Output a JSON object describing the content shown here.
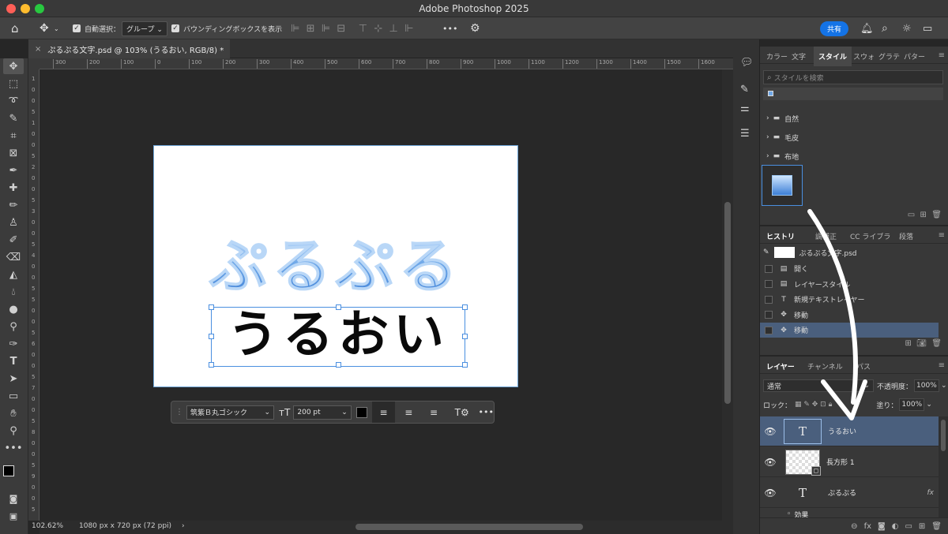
{
  "app": {
    "title": "Adobe Photoshop 2025"
  },
  "options": {
    "auto_select_label": "自動選択：",
    "auto_select_value": "グループ",
    "bbox_label": "バウンディングボックスを表示",
    "share_label": "共有",
    "more": "•••"
  },
  "document": {
    "tab_title": "ぷるぷる文字.psd @ 103% (うるおい, RGB/8) *",
    "title_text": "ぷるぷる",
    "body_text": "うるおい",
    "zoom": "102.62%",
    "dims": "1080 px x 720 px (72 ppi)"
  },
  "ruler": {
    "h_ticks": [
      "300",
      "200",
      "100",
      "0",
      "100",
      "200",
      "300",
      "400",
      "500",
      "600",
      "700",
      "800",
      "900",
      "1000",
      "1100",
      "1200",
      "1300",
      "1400",
      "1500",
      "1600"
    ],
    "v_ticks": [
      "1",
      "0",
      "0",
      "5",
      "1",
      "0",
      "0",
      "5",
      "2",
      "0",
      "0",
      "5",
      "3",
      "0",
      "0",
      "5",
      "4",
      "0",
      "0",
      "5",
      "5",
      "0",
      "0",
      "5",
      "6",
      "0",
      "0",
      "5",
      "7",
      "0",
      "0",
      "5",
      "8",
      "0",
      "0",
      "5",
      "9",
      "0",
      "0",
      "5"
    ]
  },
  "context_bar": {
    "font": "筑紫Ｂ丸ゴシック",
    "size": "200 pt",
    "more": "•••"
  },
  "styles_panel": {
    "tabs": [
      "カラー",
      "文字",
      "スタイル",
      "スウォ",
      "グラテ",
      "パター"
    ],
    "active_tab": "スタイル",
    "search_placeholder": "スタイルを検索",
    "folders": [
      "自然",
      "毛皮",
      "布地"
    ]
  },
  "history_panel": {
    "tabs": [
      "ヒストリ",
      "調補正",
      "CC ライブラ",
      "段落"
    ],
    "snapshot": "ぷるぷる文字.psd",
    "items": [
      "開く",
      "レイヤースタイル",
      "新規テキストレイヤー",
      "移動",
      "移動"
    ]
  },
  "layers_panel": {
    "tabs": [
      "レイヤー",
      "チャンネル",
      "パス"
    ],
    "blend_mode": "通常",
    "opacity_label": "不透明度：",
    "opacity": "100%",
    "lock_label": "ロック：",
    "fill_label": "塗り：",
    "fill": "100%",
    "layers": [
      {
        "name": "うるおい",
        "type": "T",
        "selected": true
      },
      {
        "name": "長方形 1",
        "type": "shape",
        "selected": false
      },
      {
        "name": "ぷるぷる",
        "type": "T",
        "selected": false,
        "fx": "fx"
      }
    ],
    "effect_label": "効果"
  },
  "colors": {
    "accent": "#1473e6",
    "selected_row": "#4a5f7d",
    "jelly_blue": "#6fa8e8"
  }
}
